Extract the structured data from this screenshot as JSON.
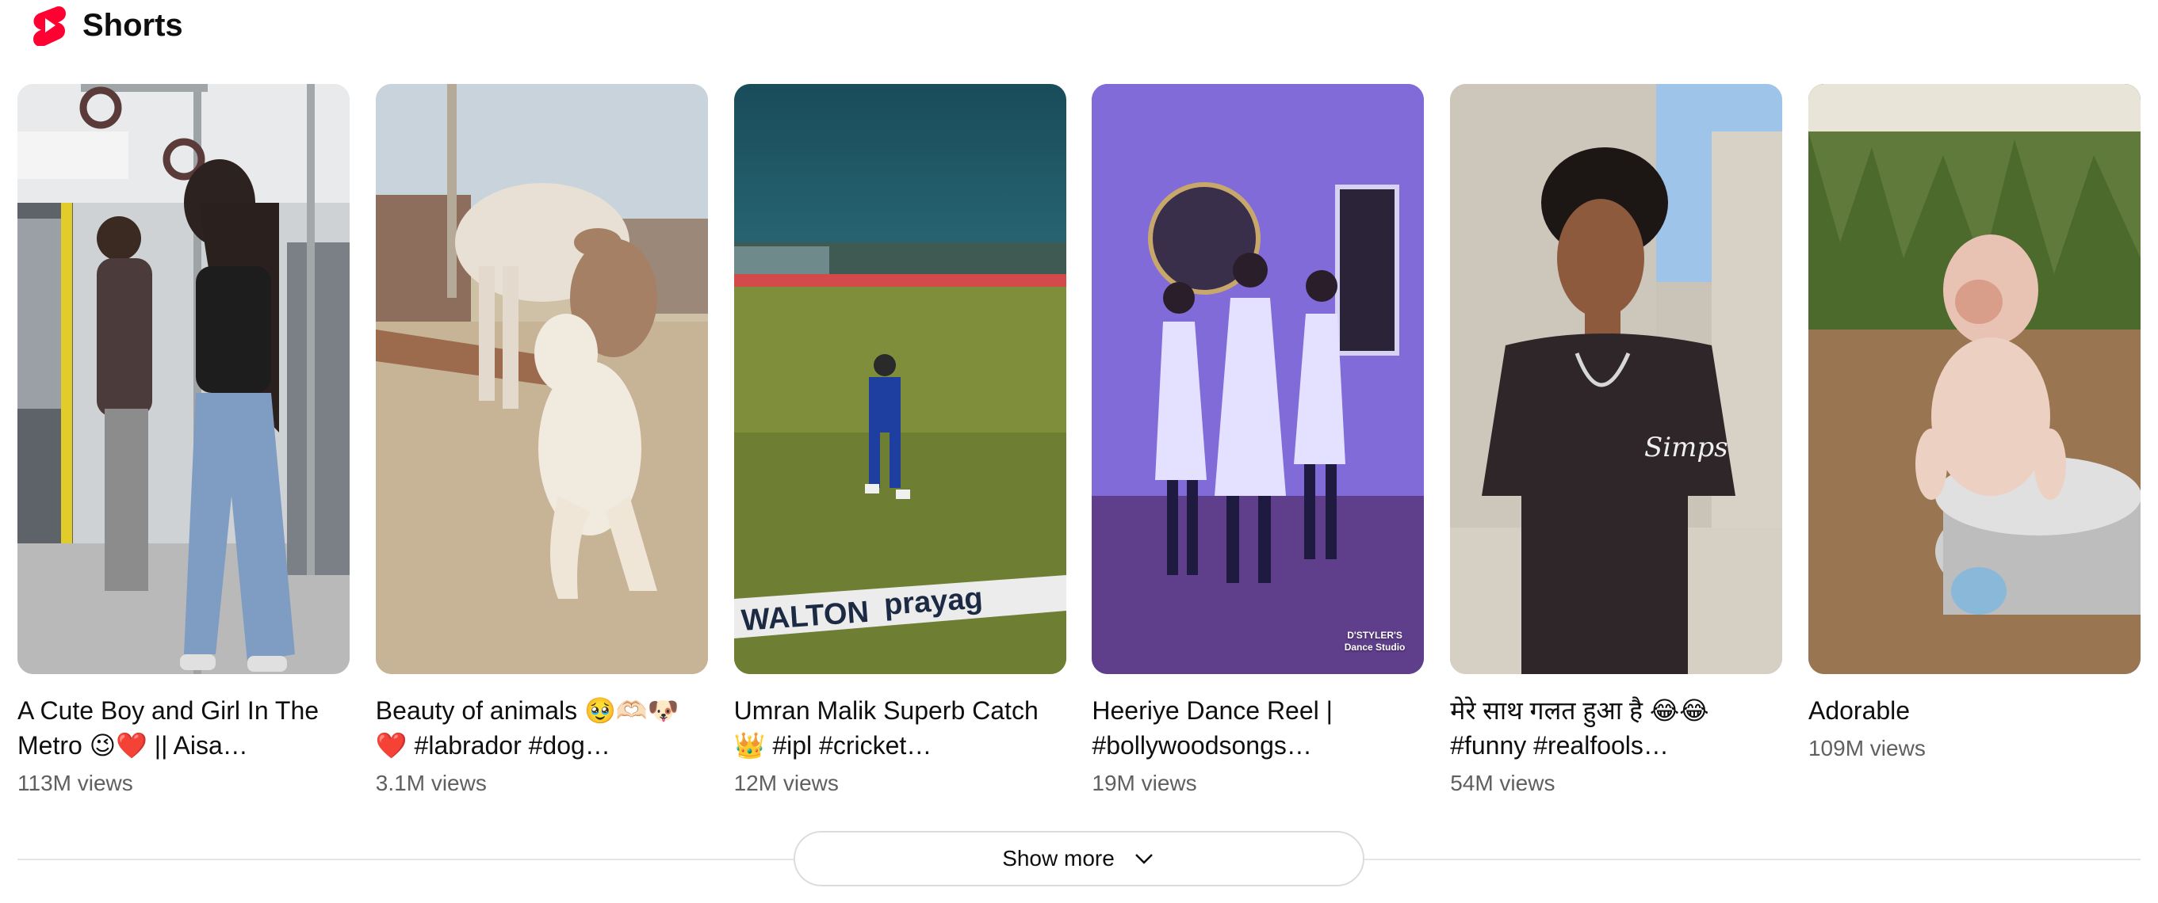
{
  "section": {
    "title": "Shorts",
    "logo_icon": "youtube-shorts-icon",
    "brand_color": "#ff0033"
  },
  "shorts": [
    {
      "title": "A Cute Boy and Girl In The Metro 😉❤️ || Aisa…",
      "views": "113M views",
      "scene": "metro-interior"
    },
    {
      "title": "Beauty of animals 🥹🫶🏻🐶 ❤️ #labrador #dog…",
      "views": "3.1M views",
      "scene": "cow-and-dog"
    },
    {
      "title": "Umran Malik Superb Catch 👑 #ipl #cricket…",
      "views": "12M views",
      "scene": "cricket-stadium"
    },
    {
      "title": "Heeriye Dance Reel | #bollywoodsongs…",
      "views": "19M views",
      "scene": "dance-studio",
      "watermark": "D'STYLER'S\nDance Studio"
    },
    {
      "title": "मेरे साथ गलत हुआ है 😂😂 #funny #realfools…",
      "views": "54M views",
      "scene": "boy-outdoors"
    },
    {
      "title": "Adorable",
      "views": "109M views",
      "scene": "baby-monkey"
    }
  ],
  "show_more": {
    "label": "Show more",
    "icon": "chevron-down-icon"
  }
}
